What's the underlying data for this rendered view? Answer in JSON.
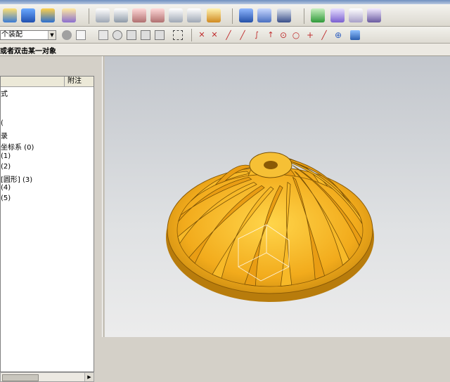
{
  "selection_bar": {
    "assembly_filter": "个装配"
  },
  "cue_line": {
    "prompt": "或者双击某一对象"
  },
  "navigator": {
    "column_attach": "附注",
    "tree_items": [
      {
        "text": "式"
      },
      {
        "text": ""
      },
      {
        "text": "("
      },
      {
        "text": "录"
      },
      {
        "text": "坐标系 (0)"
      },
      {
        "text": "(1)"
      },
      {
        "text": "(2)"
      },
      {
        "text": "[圆形] (3)"
      },
      {
        "text": "(4)"
      },
      {
        "text": "(5)"
      }
    ]
  },
  "model": {
    "part_color": "#f0a81a",
    "shadow_color": "#b87c0c",
    "background_top": "#c2c6cc",
    "background_bottom": "#ececec"
  },
  "icons": [
    "extrude-icon",
    "revolve-icon",
    "sweep-icon",
    "feature-icon",
    "sketch-icon",
    "blend-icon",
    "chamfer-icon",
    "draft-icon",
    "shell-icon",
    "thread-icon",
    "cylinder-icon",
    "hole-icon",
    "pattern-icon",
    "check-icon",
    "analysis-icon",
    "table-icon",
    "coordinate-icon",
    "view-icon",
    "snap-icon",
    "point-icon",
    "line-icon"
  ]
}
